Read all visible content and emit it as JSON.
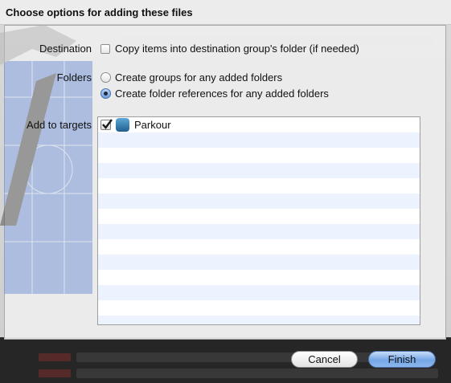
{
  "dialog": {
    "title": "Choose options for adding these files"
  },
  "destination": {
    "label": "Destination",
    "copy_items_label": "Copy items into destination group's folder (if needed)",
    "copy_items_checked": false
  },
  "folders": {
    "label": "Folders",
    "options": [
      {
        "label": "Create groups for any added folders",
        "selected": false
      },
      {
        "label": "Create folder references for any added folders",
        "selected": true
      }
    ]
  },
  "targets": {
    "label": "Add to targets",
    "items": [
      {
        "name": "Parkour",
        "checked": true,
        "icon": "app-target-icon"
      }
    ]
  },
  "buttons": {
    "cancel": "Cancel",
    "finish": "Finish"
  },
  "colors": {
    "finish_button": "#75a6e6",
    "list_stripe": "#edf3fe"
  }
}
